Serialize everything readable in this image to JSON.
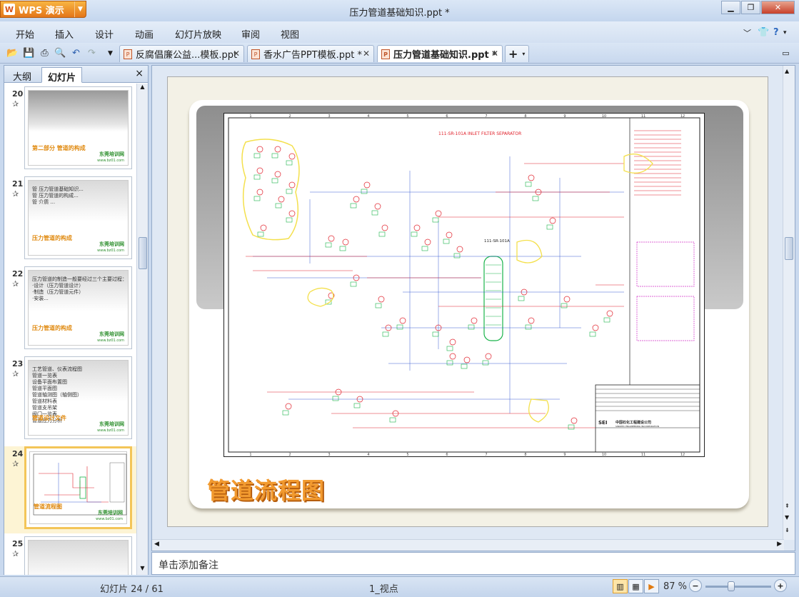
{
  "app": {
    "name": "WPS 演示",
    "logo": "W",
    "title": "压力管道基础知识.ppt *"
  },
  "menu": [
    "开始",
    "插入",
    "设计",
    "动画",
    "幻灯片放映",
    "审阅",
    "视图"
  ],
  "toolbar_icons": [
    "open-icon",
    "save-icon",
    "print-icon",
    "print-preview-icon",
    "undo-icon",
    "redo-icon",
    "customize-icon"
  ],
  "tabs": [
    {
      "label": "反腐倡廉公益...模板.ppt",
      "active": false
    },
    {
      "label": "香水广告PPT模板.ppt *",
      "active": false
    },
    {
      "label": "压力管道基础知识.ppt *",
      "active": true
    }
  ],
  "panel": {
    "tab_outline": "大纲",
    "tab_slides": "幻灯片",
    "close": "×"
  },
  "thumbnails": [
    {
      "num": "20",
      "star": "✰",
      "lines": [],
      "title": "第二部分 管道的构成",
      "brand": "东莞培训网",
      "url": "www.bz01.com",
      "selected": false
    },
    {
      "num": "21",
      "star": "✰",
      "lines": [
        "管 压力管道基础知识...",
        "管 压力管道的构成...",
        "管 介质 ..."
      ],
      "title": "压力管道的构成",
      "brand": "东莞培训网",
      "url": "www.bz01.com",
      "selected": false
    },
    {
      "num": "22",
      "star": "✰",
      "lines": [
        "压力管道的制造一般要经过三个主要过程：",
        "·设计（压力管道设计）",
        "·制造（压力管道元件）",
        "·安装..."
      ],
      "title": "压力管道的构成",
      "brand": "东莞培训网",
      "url": "www.bz01.com",
      "selected": false
    },
    {
      "num": "23",
      "star": "✰",
      "lines": [
        "工艺管道、仪表流程图",
        "管道一览表",
        "设备平面布置图",
        "管道平面图",
        "管道轴测图（轴侧图）",
        "管道材料表",
        "管道支吊架",
        "阀门一览表",
        "管道应力分析"
      ],
      "title": "管道设计文件",
      "brand": "东莞培训网",
      "url": "www.bz01.com",
      "selected": false
    },
    {
      "num": "24",
      "star": "✰",
      "lines": [],
      "title": "管道流程图",
      "brand": "东莞培训网",
      "url": "www.bz01.com",
      "selected": true
    },
    {
      "num": "25",
      "star": "✰",
      "lines": [],
      "title": "",
      "brand": "",
      "url": "",
      "selected": false
    }
  ],
  "slide": {
    "heading": "管道流程图",
    "drawing": {
      "title_block_company": "中国石化工程建设公司",
      "title_block_company_en": "SINOPEC ENGINEERING INCORPORATION",
      "logo": "SEI",
      "vessel_tag": "111-SR-101A",
      "header_tag": "111-SR-101A INLET FILTER SEPARATOR",
      "border_numbers": [
        "1",
        "2",
        "3",
        "4",
        "5",
        "6",
        "7",
        "8",
        "9",
        "10",
        "11",
        "12"
      ]
    }
  },
  "notes": {
    "placeholder": "单击添加备注"
  },
  "status": {
    "slide_counter": "幻灯片 24 / 61",
    "view_name": "1_视点",
    "zoom": "87 %"
  },
  "colors": {
    "accent_orange": "#f29a2f",
    "selection": "#f3c558",
    "brand_green": "#2d8f2d",
    "drawing_red": "#e0202a",
    "drawing_green": "#19b34a",
    "drawing_blue": "#3b5fd1",
    "drawing_magenta": "#d232c8",
    "highlight_yellow": "#f4e04d"
  }
}
